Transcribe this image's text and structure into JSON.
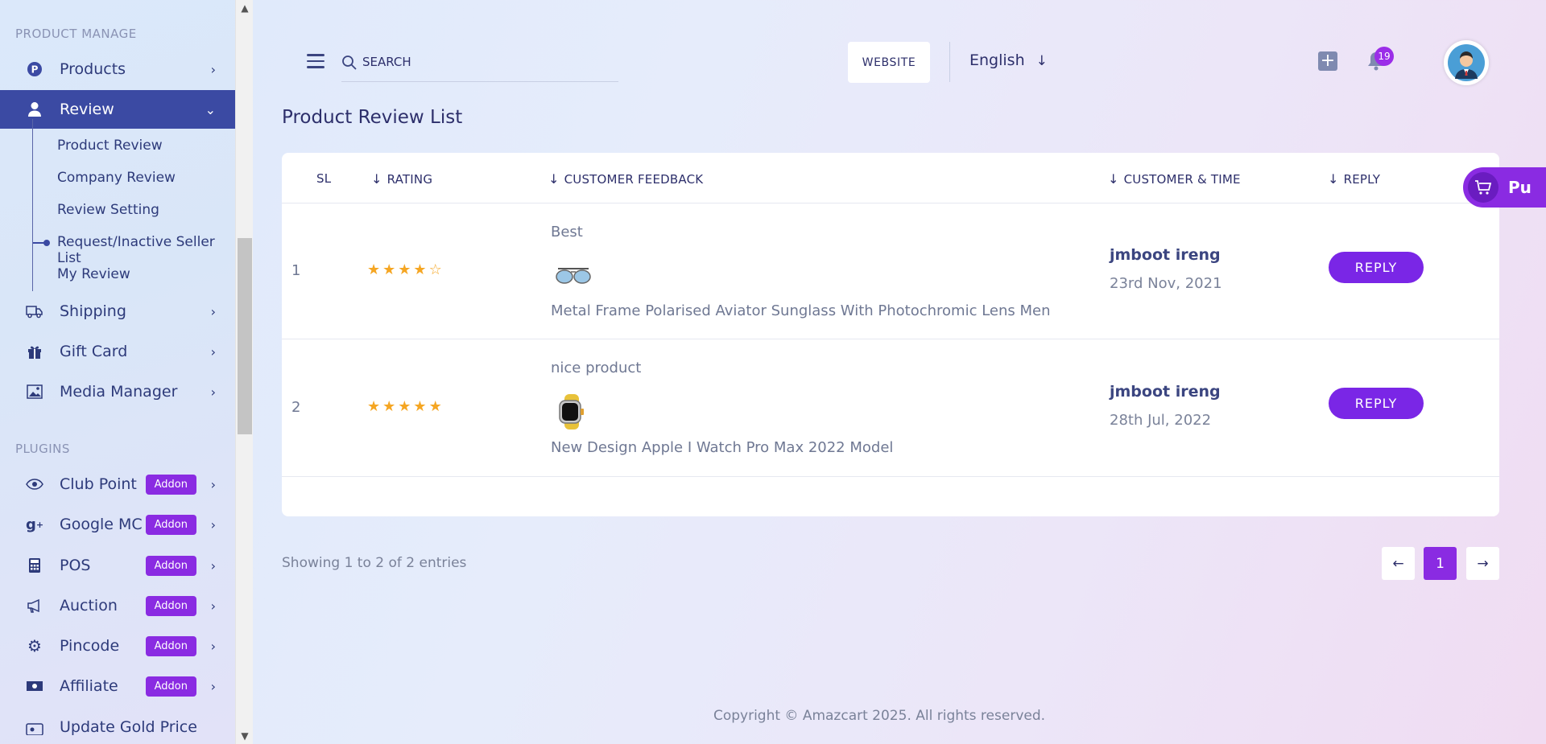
{
  "sidebar": {
    "product_manage_label": "PRODUCT MANAGE",
    "products": "Products",
    "review": "Review",
    "sub": [
      "Product Review",
      "Company Review",
      "Review Setting",
      "Request/Inactive Seller List",
      "My Review"
    ],
    "shipping": "Shipping",
    "gift_card": "Gift Card",
    "media_manager": "Media Manager",
    "plugins_label": "PLUGINS",
    "plugins": [
      {
        "label": "Club Point",
        "badge": "Addon"
      },
      {
        "label": "Google MC",
        "badge": "Addon"
      },
      {
        "label": "POS",
        "badge": "Addon"
      },
      {
        "label": "Auction",
        "badge": "Addon"
      },
      {
        "label": "Pincode",
        "badge": "Addon"
      },
      {
        "label": "Affiliate",
        "badge": "Addon"
      }
    ],
    "update_gold": "Update Gold Price"
  },
  "header": {
    "search_placeholder": "SEARCH",
    "website": "WEBSITE",
    "language": "English",
    "notification_count": "19"
  },
  "page": {
    "title": "Product Review List"
  },
  "table": {
    "columns": {
      "sl": "SL",
      "rating": "RATING",
      "feedback": "CUSTOMER FEEDBACK",
      "customer": "CUSTOMER & TIME",
      "reply": "REPLY"
    },
    "rows": [
      {
        "sl": "1",
        "rating": 4,
        "feedback": "Best",
        "product": "Metal Frame Polarised Aviator Sunglass With Photochromic Lens Men",
        "customer": "jmboot ireng",
        "time": "23rd Nov, 2021",
        "reply": "REPLY"
      },
      {
        "sl": "2",
        "rating": 5,
        "feedback": "nice product",
        "product": "New Design Apple I Watch Pro Max 2022 Model",
        "customer": "jmboot ireng",
        "time": "28th Jul, 2022",
        "reply": "REPLY"
      }
    ]
  },
  "float_button": "Pu",
  "pagination": {
    "showing": "Showing 1 to 2 of 2 entries",
    "current": "1"
  },
  "footer": {
    "copyright": "Copyright © Amazcart 2025. All rights reserved."
  },
  "colors": {
    "accent": "#8a2be2",
    "active_nav": "#3b4aa3",
    "star": "#f5a623"
  }
}
